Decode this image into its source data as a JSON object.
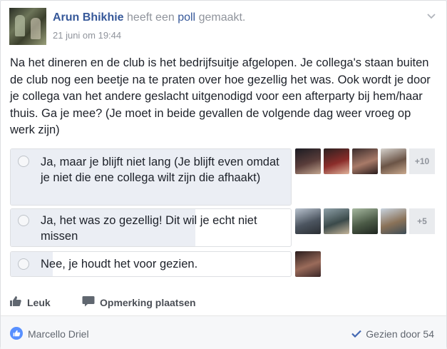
{
  "post": {
    "author": "Arun Bhikhie",
    "action_prefix": "heeft een",
    "action_link": "poll",
    "action_suffix": "gemaakt.",
    "timestamp": "21 juni om 19:44",
    "text": "Na het dineren en de club is het bedrijfsuitje afgelopen. Je collega's staan buiten de club nog een beetje na te praten over hoe gezellig het was. Ook wordt je door je collega van het andere geslacht uitgenodigd voor een afterparty bij hem/haar thuis. Ga je mee? (Je moet in beide gevallen de volgende dag weer vroeg op werk zijn)"
  },
  "poll": {
    "options": [
      {
        "label": "Ja, maar je blijft niet lang (Je blijft even omdat je niet die ene collega wilt zijn die afhaakt)",
        "fill_fraction": 1.0,
        "more_count": "+10"
      },
      {
        "label": "Ja, het was zo gezellig! Dit wil je echt niet missen",
        "fill_fraction": 0.66,
        "more_count": "+5"
      },
      {
        "label": "Nee, je houdt het voor gezien.",
        "fill_fraction": 0.15,
        "more_count": ""
      }
    ]
  },
  "actions": {
    "like_label": "Leuk",
    "comment_label": "Opmerking plaatsen"
  },
  "footer": {
    "liker": "Marcello Driel",
    "seen_label": "Gezien door 54"
  },
  "icons": {
    "chevron": "chevron-down-icon",
    "like": "thumbs-up-icon",
    "comment": "comment-icon",
    "check": "check-icon"
  },
  "colors": {
    "link": "#365899",
    "meta": "#90949c",
    "poll_fill": "#ebeef4",
    "like_badge": "#5890ff"
  }
}
